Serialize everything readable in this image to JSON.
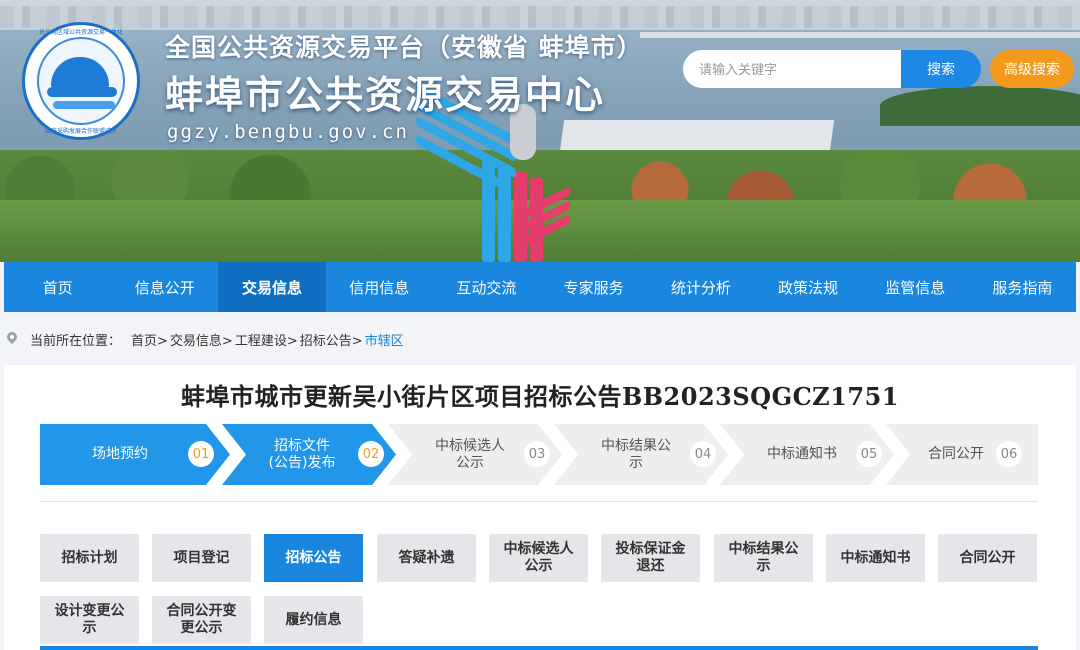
{
  "header": {
    "subtitle": "全国公共资源交易平台（安徽省 蚌埠市）",
    "title": "蚌埠市公共资源交易中心",
    "url": "ggzy.bengbu.gov.cn",
    "logo_text_top": "长三角区域公共资源交易一体化",
    "logo_text_bottom": "政府采购发展合作联盟成员"
  },
  "search": {
    "placeholder": "请输入关键字",
    "button_label": "搜索",
    "advanced_label": "高级搜索"
  },
  "nav": {
    "items": [
      "首页",
      "信息公开",
      "交易信息",
      "信用信息",
      "互动交流",
      "专家服务",
      "统计分析",
      "政策法规",
      "监管信息",
      "服务指南"
    ],
    "active": "交易信息"
  },
  "breadcrumb": {
    "prefix": "当前所在位置：",
    "items": [
      "首页>",
      "交易信息>",
      "工程建设>",
      "招标公告>"
    ],
    "current": "市辖区"
  },
  "page_title": "蚌埠市城市更新吴小街片区项目招标公告BB2023SQGCZ1751",
  "steps": [
    {
      "label_line1": "场地预约",
      "label_line2": "",
      "num": "01",
      "state": "done"
    },
    {
      "label_line1": "招标文件",
      "label_line2": "(公告)发布",
      "num": "02",
      "state": "done"
    },
    {
      "label_line1": "中标候选人",
      "label_line2": "公示",
      "num": "03",
      "state": "todo"
    },
    {
      "label_line1": "中标结果公",
      "label_line2": "示",
      "num": "04",
      "state": "todo"
    },
    {
      "label_line1": "中标通知书",
      "label_line2": "",
      "num": "05",
      "state": "todo"
    },
    {
      "label_line1": "合同公开",
      "label_line2": "",
      "num": "06",
      "state": "todo"
    }
  ],
  "tabs": [
    {
      "line1": "招标计划",
      "line2": ""
    },
    {
      "line1": "项目登记",
      "line2": ""
    },
    {
      "line1": "招标公告",
      "line2": "",
      "active": true
    },
    {
      "line1": "答疑补遗",
      "line2": ""
    },
    {
      "line1": "中标候选人",
      "line2": "公示"
    },
    {
      "line1": "投标保证金",
      "line2": "退还"
    },
    {
      "line1": "中标结果公",
      "line2": "示"
    },
    {
      "line1": "中标通知书",
      "line2": ""
    },
    {
      "line1": "合同公开",
      "line2": ""
    },
    {
      "line1": "设计变更公",
      "line2": "示"
    },
    {
      "line1": "合同公开变",
      "line2": "更公示"
    },
    {
      "line1": "履约信息",
      "line2": ""
    }
  ],
  "colors": {
    "primary": "#1a86dd",
    "nav_active": "#0f6ebf",
    "accent": "#f39a1e",
    "step_done": "#2296e8",
    "step_todo": "#eceef0"
  },
  "icons": {
    "breadcrumb": "location-pin-icon"
  }
}
